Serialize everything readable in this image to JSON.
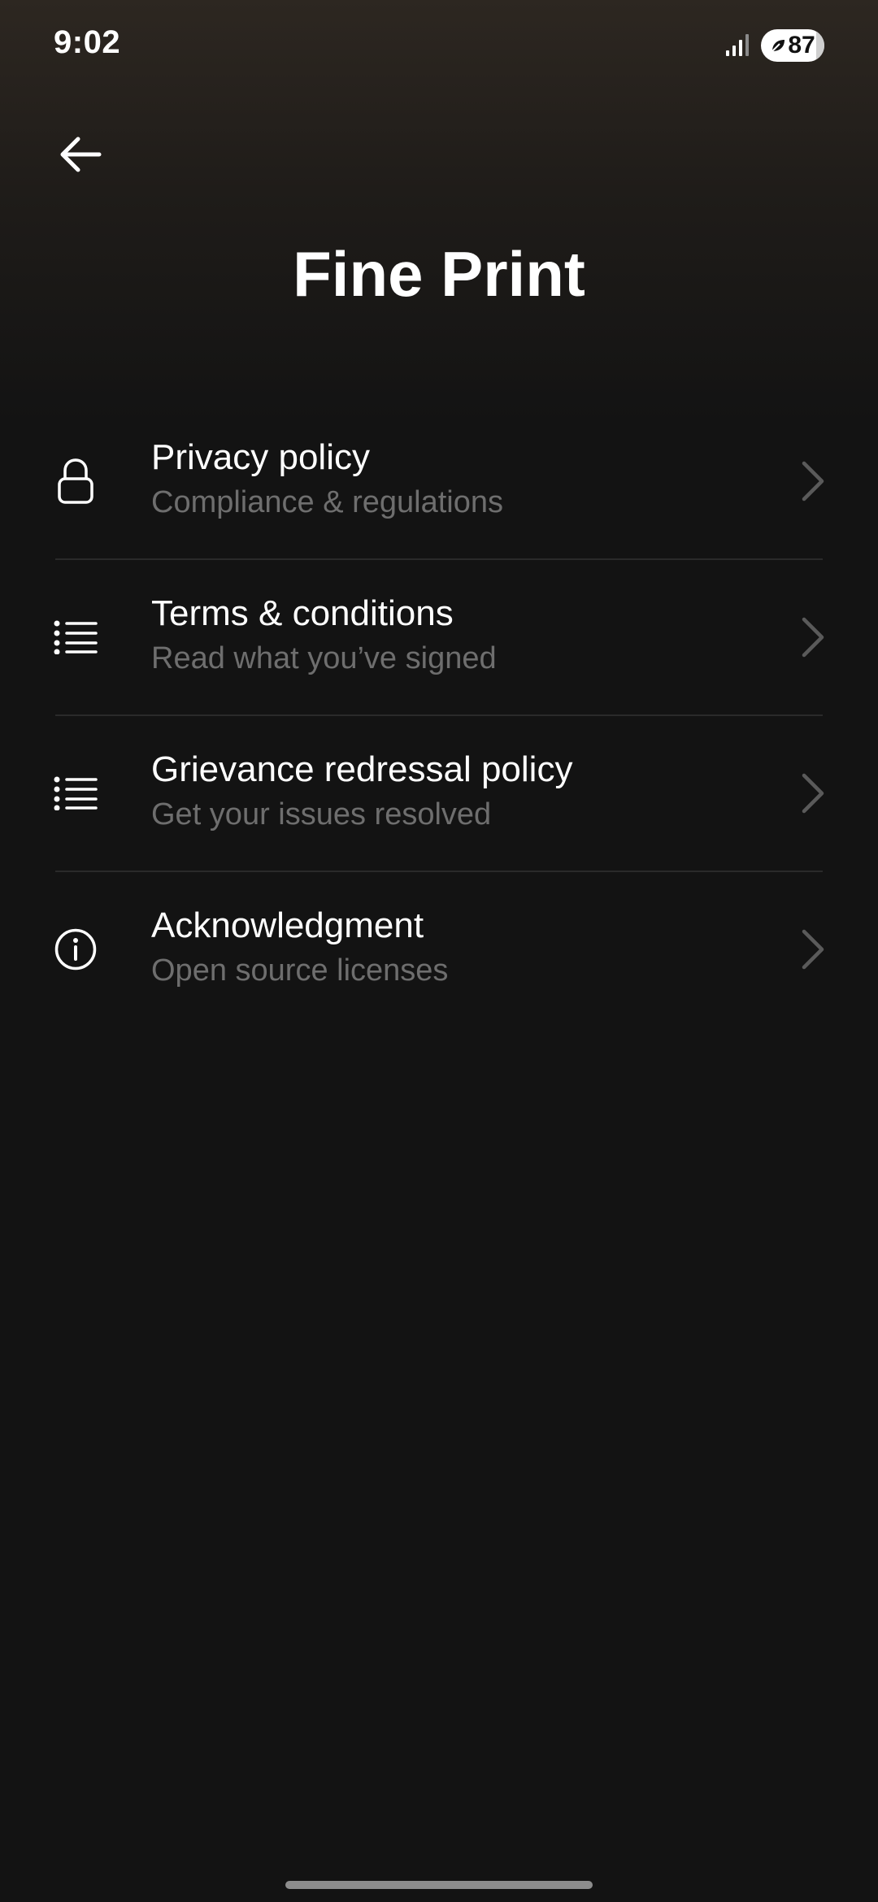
{
  "status_bar": {
    "time": "9:02",
    "battery_level": "87"
  },
  "header": {
    "back_icon": "arrow-left-icon",
    "title": "Fine Print"
  },
  "menu": {
    "items": [
      {
        "icon": "lock-icon",
        "title": "Privacy policy",
        "subtitle": "Compliance & regulations"
      },
      {
        "icon": "list-icon",
        "title": "Terms & conditions",
        "subtitle": "Read what you’ve signed"
      },
      {
        "icon": "list-icon",
        "title": "Grievance redressal policy",
        "subtitle": "Get your issues resolved"
      },
      {
        "icon": "info-icon",
        "title": "Acknowledgment",
        "subtitle": "Open source licenses"
      }
    ]
  },
  "colors": {
    "background": "#131313",
    "header_gradient_top": "#2d2721",
    "subtitle": "#6e6e6e",
    "divider": "#2a2a2a",
    "chevron": "#5a5a5a"
  }
}
